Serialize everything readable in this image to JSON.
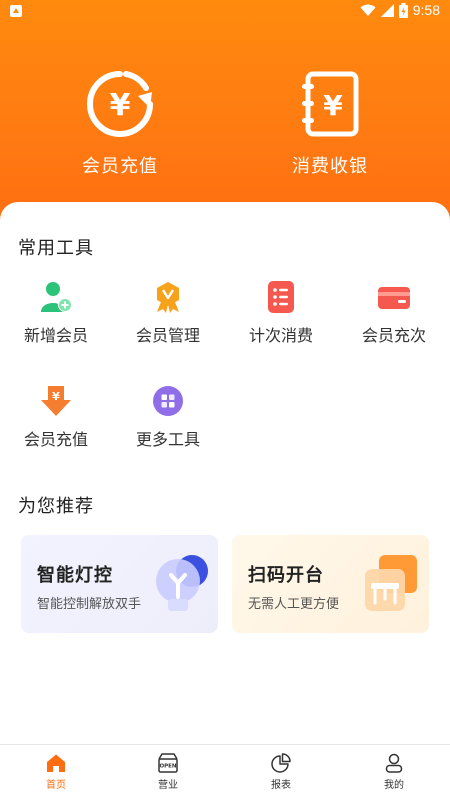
{
  "status_bar": {
    "time": "9:58"
  },
  "hero": [
    {
      "label": "会员充值",
      "icon_glyph": "¥"
    },
    {
      "label": "消费收银",
      "icon_glyph": "¥"
    }
  ],
  "common_tools": {
    "title": "常用工具",
    "items": [
      {
        "label": "新增会员",
        "icon": "add-member-icon",
        "color": "#2bc27a"
      },
      {
        "label": "会员管理",
        "icon": "member-badge-icon",
        "color": "#f7a21b"
      },
      {
        "label": "计次消费",
        "icon": "list-icon",
        "color": "#f5584e"
      },
      {
        "label": "会员充次",
        "icon": "card-icon",
        "color": "#f5584e"
      },
      {
        "label": "会员充值",
        "icon": "recharge-icon",
        "color": "#f57d30"
      },
      {
        "label": "更多工具",
        "icon": "grid-icon",
        "color": "#8f6ee8"
      }
    ]
  },
  "recommend": {
    "title": "为您推荐",
    "cards": [
      {
        "title": "智能灯控",
        "subtitle": "智能控制解放双手",
        "icon": "light-bulb-icon"
      },
      {
        "title": "扫码开台",
        "subtitle": "无需人工更方便",
        "icon": "table-icon"
      }
    ]
  },
  "tabbar": {
    "items": [
      {
        "label": "首页",
        "icon": "home-icon",
        "active": true
      },
      {
        "label": "营业",
        "icon": "shop-icon",
        "active": false,
        "badge_text": "OPEN"
      },
      {
        "label": "报表",
        "icon": "pie-chart-icon",
        "active": false
      },
      {
        "label": "我的",
        "icon": "user-icon",
        "active": false
      }
    ]
  },
  "colors": {
    "brand": "#ff7a12",
    "active_tab": "#ff6d10"
  }
}
